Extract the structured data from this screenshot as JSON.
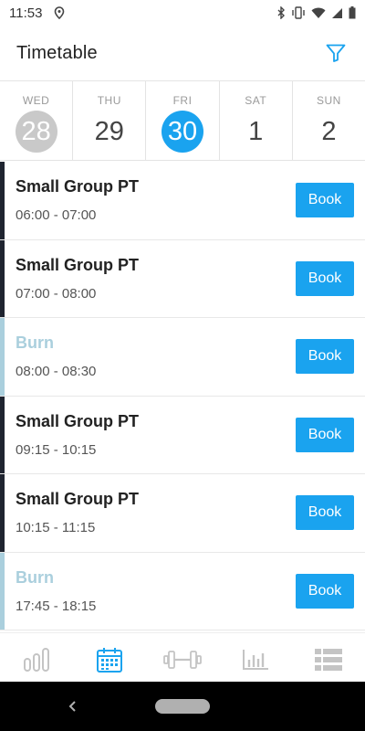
{
  "status_bar": {
    "time": "11:53",
    "icons": [
      "location-icon",
      "bluetooth-icon",
      "vibrate-icon",
      "wifi-icon",
      "signal-icon",
      "battery-icon"
    ]
  },
  "header": {
    "title": "Timetable",
    "filter_icon": "filter-icon"
  },
  "colors": {
    "accent": "#1aa3ef",
    "dark_bar": "#1f2430",
    "light_bar": "#aacfdd",
    "past_day": "#c9c9c9"
  },
  "days": [
    {
      "name": "WED",
      "num": "28",
      "state": "past"
    },
    {
      "name": "THU",
      "num": "29",
      "state": "normal"
    },
    {
      "name": "FRI",
      "num": "30",
      "state": "selected"
    },
    {
      "name": "SAT",
      "num": "1",
      "state": "normal"
    },
    {
      "name": "SUN",
      "num": "2",
      "state": "normal"
    }
  ],
  "sessions": [
    {
      "name": "Small Group PT",
      "time": "06:00 - 07:00",
      "button": "Book",
      "style": "dark"
    },
    {
      "name": "Small Group PT",
      "time": "07:00 - 08:00",
      "button": "Book",
      "style": "dark"
    },
    {
      "name": "Burn",
      "time": "08:00 - 08:30",
      "button": "Book",
      "style": "light"
    },
    {
      "name": "Small Group PT",
      "time": "09:15 - 10:15",
      "button": "Book",
      "style": "dark"
    },
    {
      "name": "Small Group PT",
      "time": "10:15 - 11:15",
      "button": "Book",
      "style": "dark"
    },
    {
      "name": "Burn",
      "time": "17:45 - 18:15",
      "button": "Book",
      "style": "light"
    }
  ],
  "bottom_nav": [
    {
      "icon": "progress-bars-icon",
      "active": false
    },
    {
      "icon": "calendar-icon",
      "active": true
    },
    {
      "icon": "dumbbell-icon",
      "active": false
    },
    {
      "icon": "bar-chart-icon",
      "active": false
    },
    {
      "icon": "list-icon",
      "active": false
    }
  ]
}
